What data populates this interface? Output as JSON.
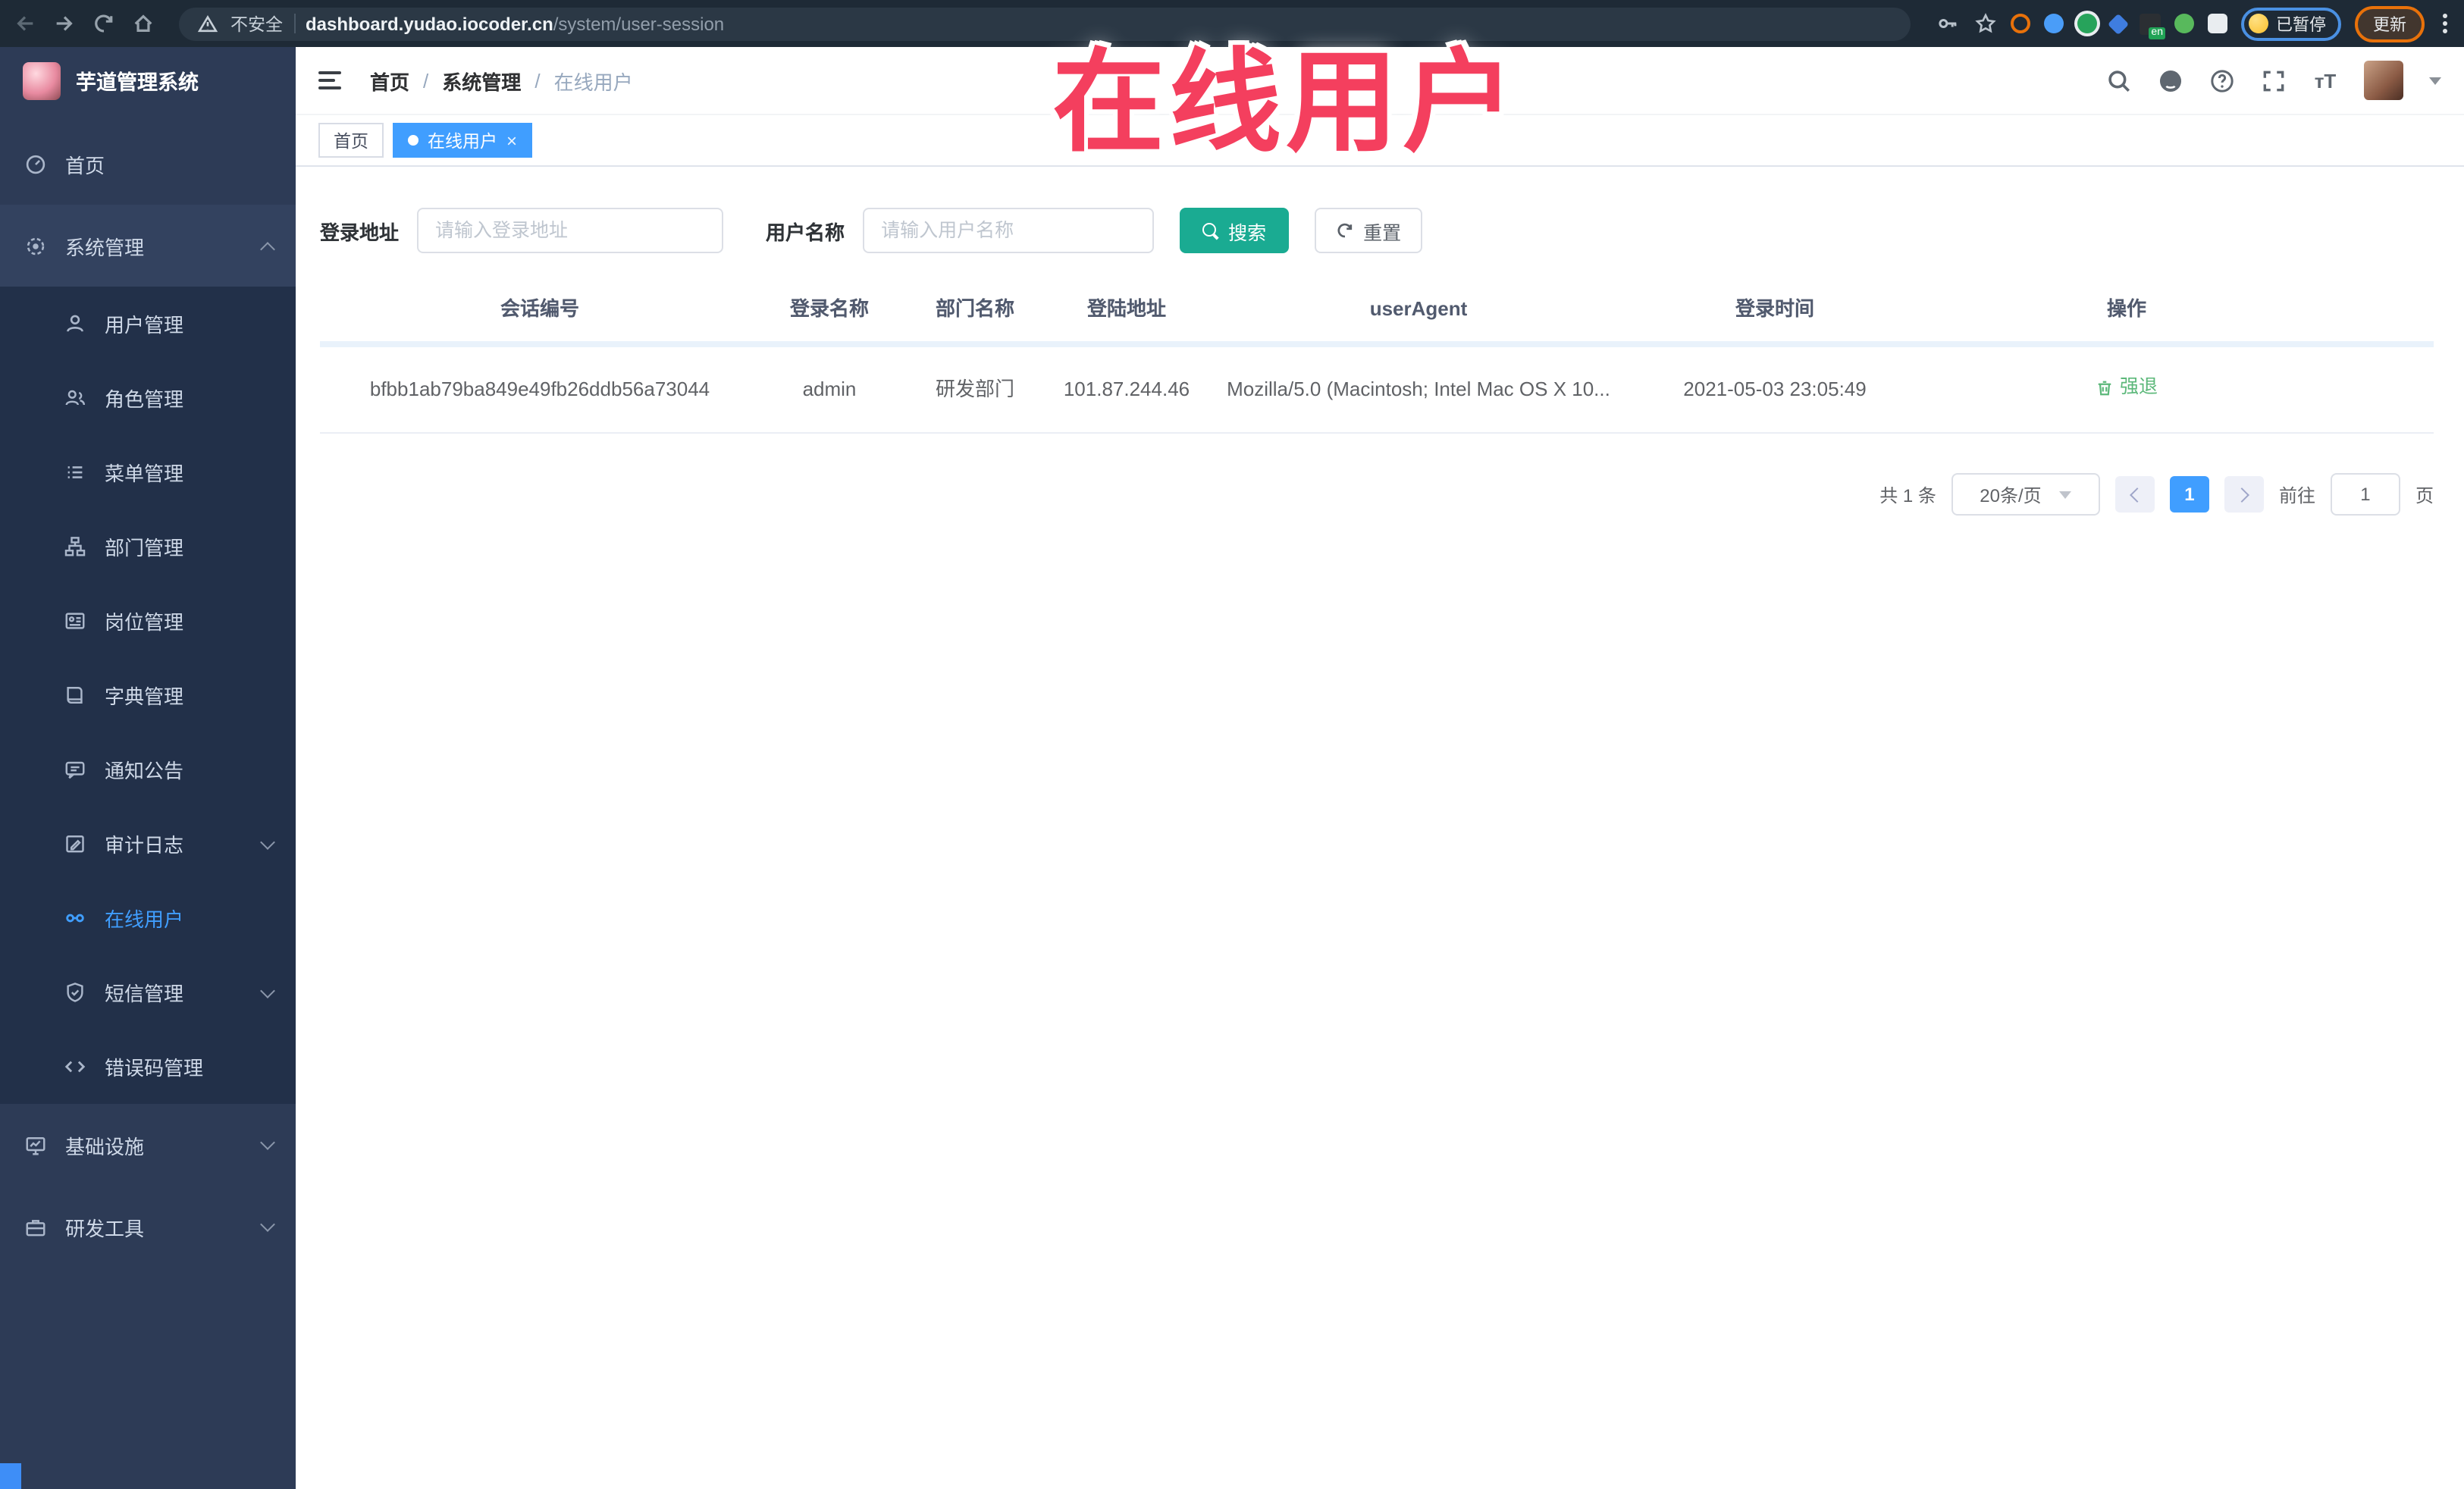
{
  "browser": {
    "security_label": "不安全",
    "url_domain": "dashboard.yudao.iocoder.cn",
    "url_path": "/system/user-session",
    "paused_label": "已暂停",
    "update_label": "更新",
    "en_badge": "en"
  },
  "watermark": "在线用户",
  "sidebar": {
    "logo_title": "芋道管理系统",
    "items": [
      {
        "label": "首页",
        "icon": "dashboard"
      },
      {
        "label": "系统管理",
        "icon": "gear",
        "state": "expanded"
      },
      {
        "label": "用户管理",
        "icon": "user"
      },
      {
        "label": "角色管理",
        "icon": "users"
      },
      {
        "label": "菜单管理",
        "icon": "menu-list"
      },
      {
        "label": "部门管理",
        "icon": "org-tree"
      },
      {
        "label": "岗位管理",
        "icon": "id-card"
      },
      {
        "label": "字典管理",
        "icon": "dictionary"
      },
      {
        "label": "通知公告",
        "icon": "announcement"
      },
      {
        "label": "审计日志",
        "icon": "audit-log",
        "state": "collapsed"
      },
      {
        "label": "在线用户",
        "icon": "online-user",
        "state": "active"
      },
      {
        "label": "短信管理",
        "icon": "sms",
        "state": "collapsed"
      },
      {
        "label": "错误码管理",
        "icon": "error-code"
      },
      {
        "label": "基础设施",
        "icon": "infrastructure",
        "state": "collapsed"
      },
      {
        "label": "研发工具",
        "icon": "dev-tools",
        "state": "collapsed"
      }
    ]
  },
  "header": {
    "breadcrumb": [
      "首页",
      "系统管理",
      "在线用户"
    ],
    "separator": "/"
  },
  "tags": [
    {
      "label": "首页",
      "active": false
    },
    {
      "label": "在线用户",
      "active": true
    }
  ],
  "filters": {
    "login_address_label": "登录地址",
    "login_address_placeholder": "请输入登录地址",
    "username_label": "用户名称",
    "username_placeholder": "请输入用户名称",
    "search_label": "搜索",
    "reset_label": "重置"
  },
  "table": {
    "columns": [
      "会话编号",
      "登录名称",
      "部门名称",
      "登陆地址",
      "userAgent",
      "登录时间",
      "操作"
    ],
    "rows": [
      {
        "session_id": "bfbb1ab79ba849e49fb26ddb56a73044",
        "username": "admin",
        "dept": "研发部门",
        "ip": "101.87.244.46",
        "user_agent": "Mozilla/5.0 (Macintosh; Intel Mac OS X 10...",
        "login_time": "2021-05-03 23:05:49",
        "action": "强退"
      }
    ]
  },
  "pagination": {
    "total_label": "共 1 条",
    "page_size": "20条/页",
    "current_page": "1",
    "goto_label": "前往",
    "goto_value": "1",
    "page_unit": "页"
  },
  "colors": {
    "accent_blue": "#409EFF",
    "search_teal": "#1aab92",
    "watermark_red": "#f43f5e",
    "action_green": "#5CB87A",
    "sidebar_bg": "#2d3b56",
    "submenu_bg": "#223049"
  }
}
